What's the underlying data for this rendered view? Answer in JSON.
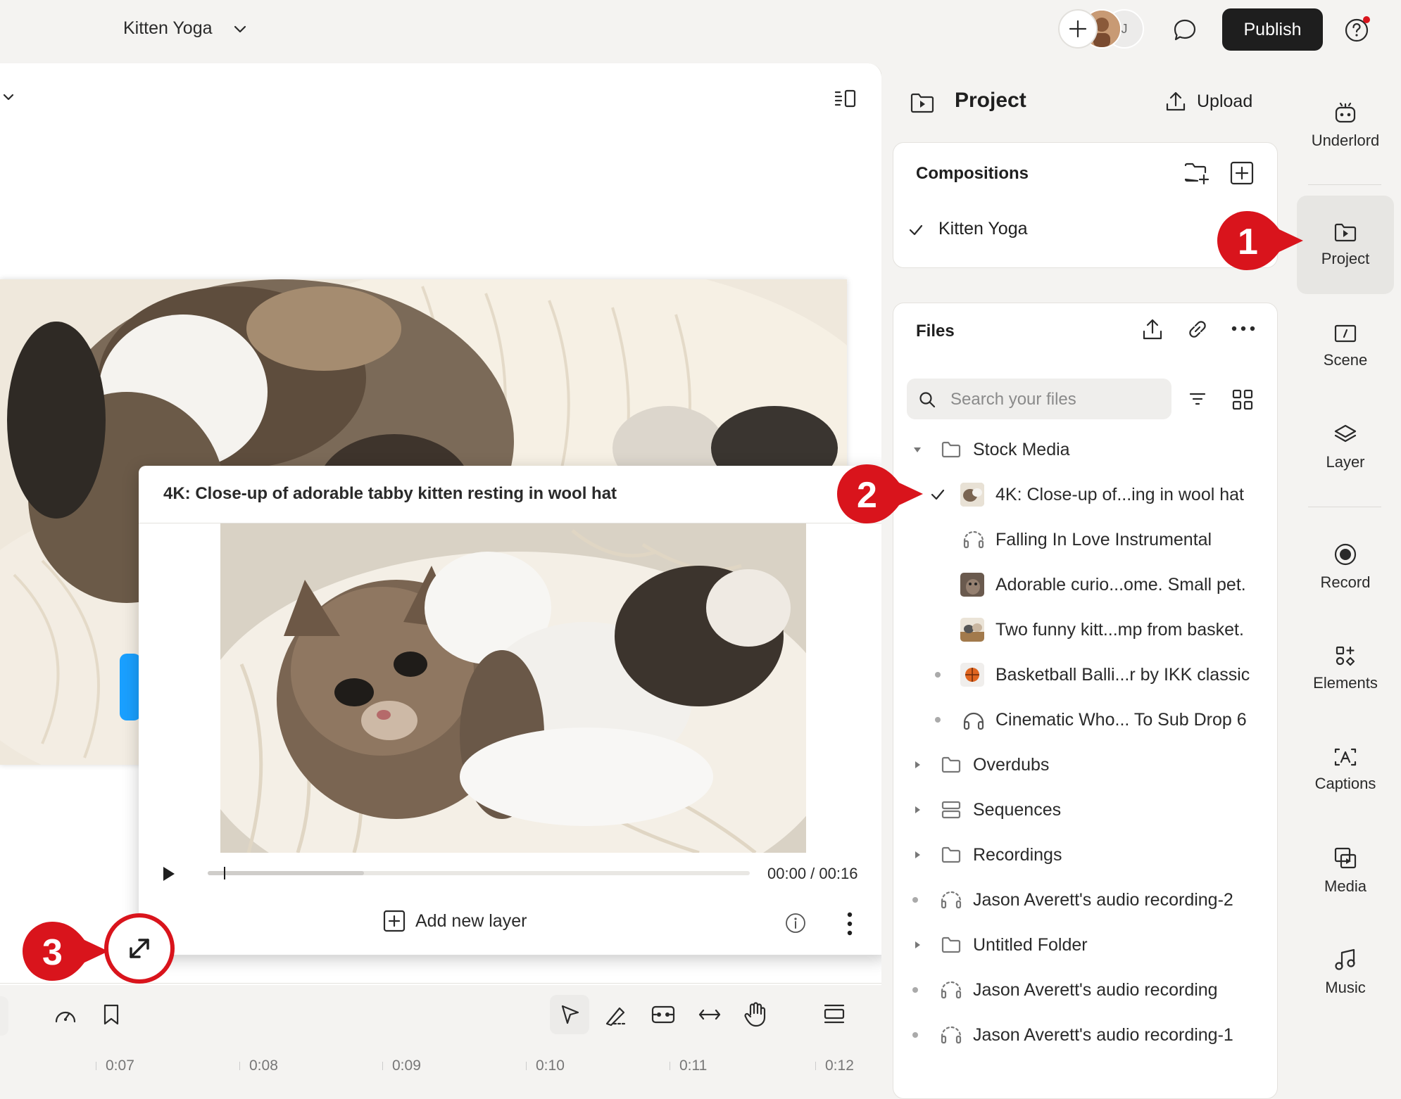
{
  "topbar": {
    "composition_title": "Kitten Yoga",
    "collaborator_initial": "J",
    "publish_label": "Publish"
  },
  "preview": {
    "title": "4K: Close-up of adorable tabby kitten resting in wool hat",
    "time": "00:00 / 00:16",
    "progress_fraction": 0.03,
    "add_layer_label": "Add new layer"
  },
  "timeline": {
    "ticks": [
      "0:07",
      "0:08",
      "0:09",
      "0:10",
      "0:11",
      "0:12"
    ]
  },
  "project": {
    "title": "Project",
    "upload_label": "Upload",
    "compositions_title": "Compositions",
    "active_composition": "Kitten Yoga",
    "files_title": "Files",
    "search_placeholder": "Search your files",
    "tree": [
      {
        "label": "Stock Media",
        "type": "folder",
        "expanded": true
      },
      {
        "label": "4K: Close-up of...ing in wool hat",
        "type": "video",
        "selected": true
      },
      {
        "label": "Falling In Love Instrumental",
        "type": "audio"
      },
      {
        "label": "Adorable curio...ome. Small pet.",
        "type": "video"
      },
      {
        "label": "Two funny kitt...mp from basket.",
        "type": "video"
      },
      {
        "label": "Basketball Balli...r by IKK classic",
        "type": "video"
      },
      {
        "label": "Cinematic Who... To Sub Drop 6",
        "type": "music"
      },
      {
        "label": "Overdubs",
        "type": "folder"
      },
      {
        "label": "Sequences",
        "type": "sequence"
      },
      {
        "label": "Recordings",
        "type": "folder"
      },
      {
        "label": "Jason Averett's audio recording-2",
        "type": "audio"
      },
      {
        "label": "Untitled Folder",
        "type": "folder"
      },
      {
        "label": "Jason Averett's audio recording",
        "type": "audio"
      },
      {
        "label": "Jason Averett's audio recording-1",
        "type": "audio"
      }
    ]
  },
  "sidebar": {
    "items": [
      {
        "label": "Underlord",
        "icon": "robot-icon"
      },
      {
        "label": "Project",
        "icon": "folder-play-icon",
        "active": true
      },
      {
        "label": "Scene",
        "icon": "scene-icon"
      },
      {
        "label": "Layer",
        "icon": "layers-icon"
      },
      {
        "label": "Record",
        "icon": "record-icon"
      },
      {
        "label": "Elements",
        "icon": "elements-icon"
      },
      {
        "label": "Captions",
        "icon": "captions-icon"
      },
      {
        "label": "Media",
        "icon": "media-icon"
      },
      {
        "label": "Music",
        "icon": "music-icon"
      }
    ]
  },
  "annotations": {
    "callout_1": "1",
    "callout_2": "2",
    "callout_3": "3"
  },
  "colors": {
    "accent_red": "#d9141c",
    "publish_bg": "#1e1e1e",
    "selection_blue": "#1aa0ff"
  }
}
